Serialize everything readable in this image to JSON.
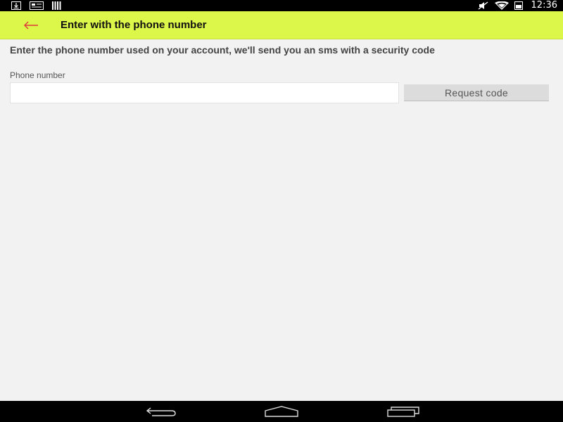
{
  "status_bar": {
    "time": "12:36",
    "left_icons": [
      "download-icon",
      "message-icon",
      "barcode-icon"
    ],
    "right_icons": [
      "mute-icon",
      "wifi-icon",
      "battery-icon"
    ]
  },
  "app_bar": {
    "back_icon": "arrow-left-icon",
    "title": "Enter with the phone number",
    "background": "#dcf749",
    "back_color": "#e0383b"
  },
  "form": {
    "instructions": "Enter the phone number used on your account, we'll send you an sms with a security code",
    "phone_label": "Phone number",
    "phone_value": "",
    "phone_placeholder": "",
    "request_button_label": "Request code"
  },
  "nav_bar": {
    "items": [
      "back-icon",
      "home-icon",
      "recents-icon"
    ]
  }
}
